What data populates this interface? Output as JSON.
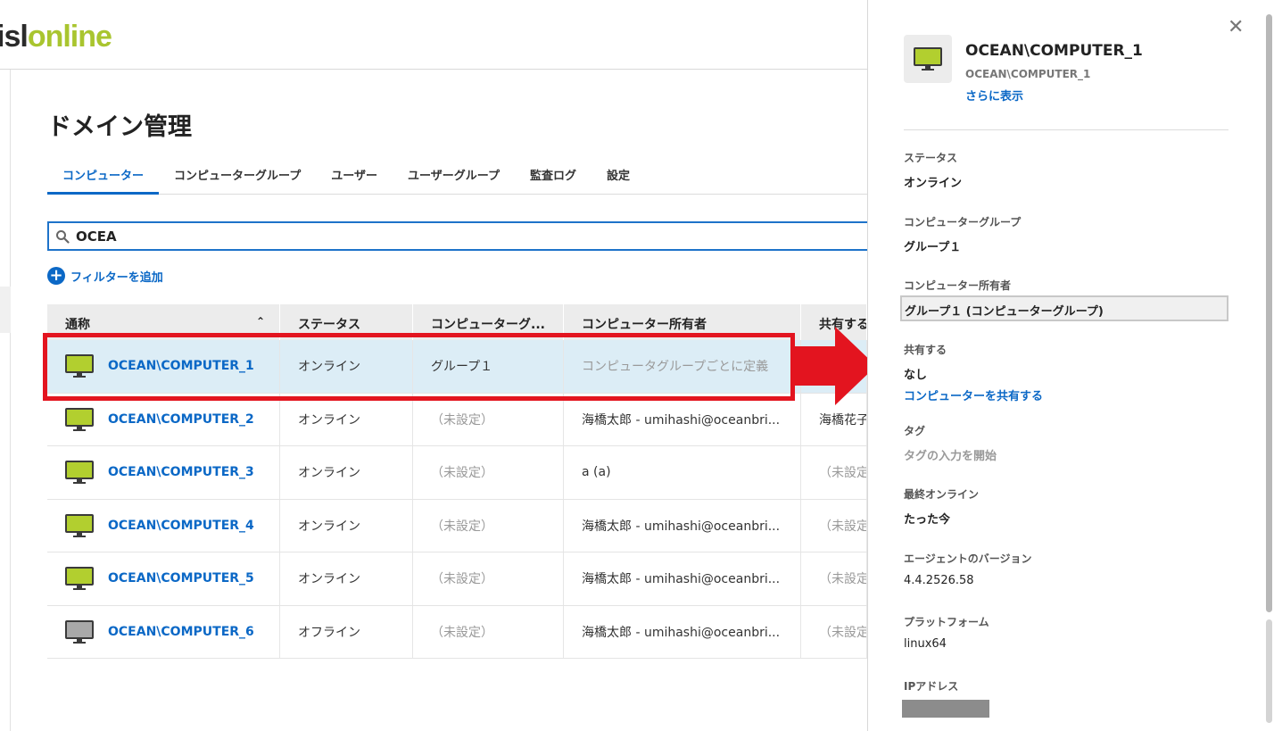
{
  "header": {
    "logo_isl": "isl",
    "logo_online": "online"
  },
  "page": {
    "title": "ドメイン管理"
  },
  "tabs": [
    {
      "label": "コンピューター",
      "active": true
    },
    {
      "label": "コンピューターグループ"
    },
    {
      "label": "ユーザー"
    },
    {
      "label": "ユーザーグループ"
    },
    {
      "label": "監査ログ"
    },
    {
      "label": "設定"
    }
  ],
  "search": {
    "value": "OCEA"
  },
  "filter": {
    "add_label": "フィルターを追加"
  },
  "table": {
    "headers": [
      "通称",
      "ステータス",
      "コンピューターグ...",
      "コンピューター所有者",
      "共有する"
    ],
    "rows": [
      {
        "name": "OCEAN\\COMPUTER_1",
        "status": "オンライン",
        "group": "グループ１",
        "owner": "コンピュータグループごとに定義",
        "shared": ""
      },
      {
        "name": "OCEAN\\COMPUTER_2",
        "status": "オンライン",
        "group": "（未設定）",
        "owner": "海橋太郎 - umihashi@oceanbri...",
        "shared": "海橋花子"
      },
      {
        "name": "OCEAN\\COMPUTER_3",
        "status": "オンライン",
        "group": "（未設定）",
        "owner": "a (a)",
        "shared": "（未設定"
      },
      {
        "name": "OCEAN\\COMPUTER_4",
        "status": "オンライン",
        "group": "（未設定）",
        "owner": "海橋太郎 - umihashi@oceanbri...",
        "shared": "（未設定"
      },
      {
        "name": "OCEAN\\COMPUTER_5",
        "status": "オンライン",
        "group": "（未設定）",
        "owner": "海橋太郎 - umihashi@oceanbri...",
        "shared": "（未設定"
      },
      {
        "name": "OCEAN\\COMPUTER_6",
        "status": "オフライン",
        "group": "（未設定）",
        "owner": "海橋太郎 - umihashi@oceanbri...",
        "shared": "（未設定"
      }
    ]
  },
  "panel": {
    "title": "OCEAN\\COMPUTER_1",
    "subtitle": "OCEAN\\COMPUTER_1",
    "show_more": "さらに表示",
    "status_label": "ステータス",
    "status_value": "オンライン",
    "group_label": "コンピューターグループ",
    "group_value": "グループ１",
    "owner_label": "コンピューター所有者",
    "owner_value": "グループ１ (コンピューターグループ)",
    "share_label": "共有する",
    "share_value": "なし",
    "share_link": "コンピューターを共有する",
    "tag_label": "タグ",
    "tag_placeholder": "タグの入力を開始",
    "last_online_label": "最終オンライン",
    "last_online_value": "たった今",
    "agent_label": "エージェントのバージョン",
    "agent_value": "4.4.2526.58",
    "platform_label": "プラットフォーム",
    "platform_value": "linux64",
    "ip_label": "IPアドレス"
  },
  "colors": {
    "accent": "#0b68c6",
    "brand_green": "#a9c52f",
    "monitor_online": "#b2cf2f",
    "monitor_offline": "#a9a9a9",
    "annotation_red": "#e3141f",
    "selected_row": "#dcedf6"
  },
  "icons": {
    "search": "search-icon",
    "add": "plus-circle-icon",
    "sort": "chevron-up-icon",
    "close": "close-icon",
    "computer": "monitor-icon"
  }
}
